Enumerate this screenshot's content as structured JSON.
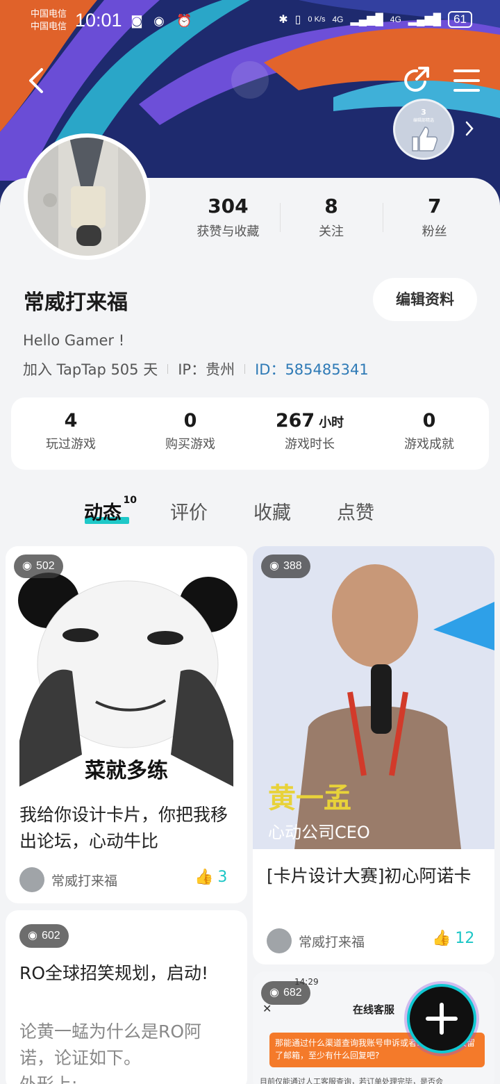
{
  "status_bar": {
    "carrier_1": "中国电信",
    "carrier_2": "中国电信",
    "time": "10:01",
    "network_speed": "0 K/s",
    "signal_1": "4G",
    "signal_2": "4G",
    "battery": "61"
  },
  "badge": {
    "level": "3",
    "caption": "编辑部精选"
  },
  "profile": {
    "stats": [
      {
        "value": "304",
        "label": "获赞与收藏"
      },
      {
        "value": "8",
        "label": "关注"
      },
      {
        "value": "7",
        "label": "粉丝"
      }
    ],
    "name": "常威打来福",
    "edit_label": "编辑资料",
    "bio": "Hello Gamer !",
    "join": "加入 TapTap 505 天",
    "ip": "IP：贵州",
    "id": "ID：585485341"
  },
  "game_stats": [
    {
      "value": "4",
      "unit": "",
      "label": "玩过游戏"
    },
    {
      "value": "0",
      "unit": "",
      "label": "购买游戏"
    },
    {
      "value": "267",
      "unit": "小时",
      "label": "游戏时长"
    },
    {
      "value": "0",
      "unit": "",
      "label": "游戏成就"
    }
  ],
  "tabs": [
    {
      "label": "动态",
      "count": "10"
    },
    {
      "label": "评价"
    },
    {
      "label": "收藏"
    },
    {
      "label": "点赞"
    }
  ],
  "posts": [
    {
      "views": "502",
      "image_caption": "菜就多练",
      "title": "我给你设计卡片，你把我移出论坛，心动牛比",
      "author": "常威打来福",
      "likes": "3"
    },
    {
      "views": "388",
      "image_caption_1": "黄一孟",
      "image_caption_2": "心动公司CEO",
      "title": "[卡片设计大赛]初心阿诺卡",
      "author": "常威打来福",
      "likes": "12"
    },
    {
      "views": "602",
      "title": "RO全球招笑规划，启动!",
      "excerpt_1": "论黄一蜢为什么是RO阿",
      "excerpt_2": "诺，论证如下。",
      "excerpt_3": "外形上:"
    },
    {
      "views": "682",
      "shot_time": "14:29",
      "shot_title": "在线客服",
      "shot_text": "那能通过什么渠道查询我账号申诉或者……？我昨天留了邮箱，至少有什么回复吧?",
      "shot_reply": "目前仅能通过人工客服查询，若订单处理完毕，是否会"
    }
  ],
  "colors": {
    "accent": "#1ec8c8",
    "id_blue": "#2e7ab6",
    "banner": "#1e2a6e"
  }
}
